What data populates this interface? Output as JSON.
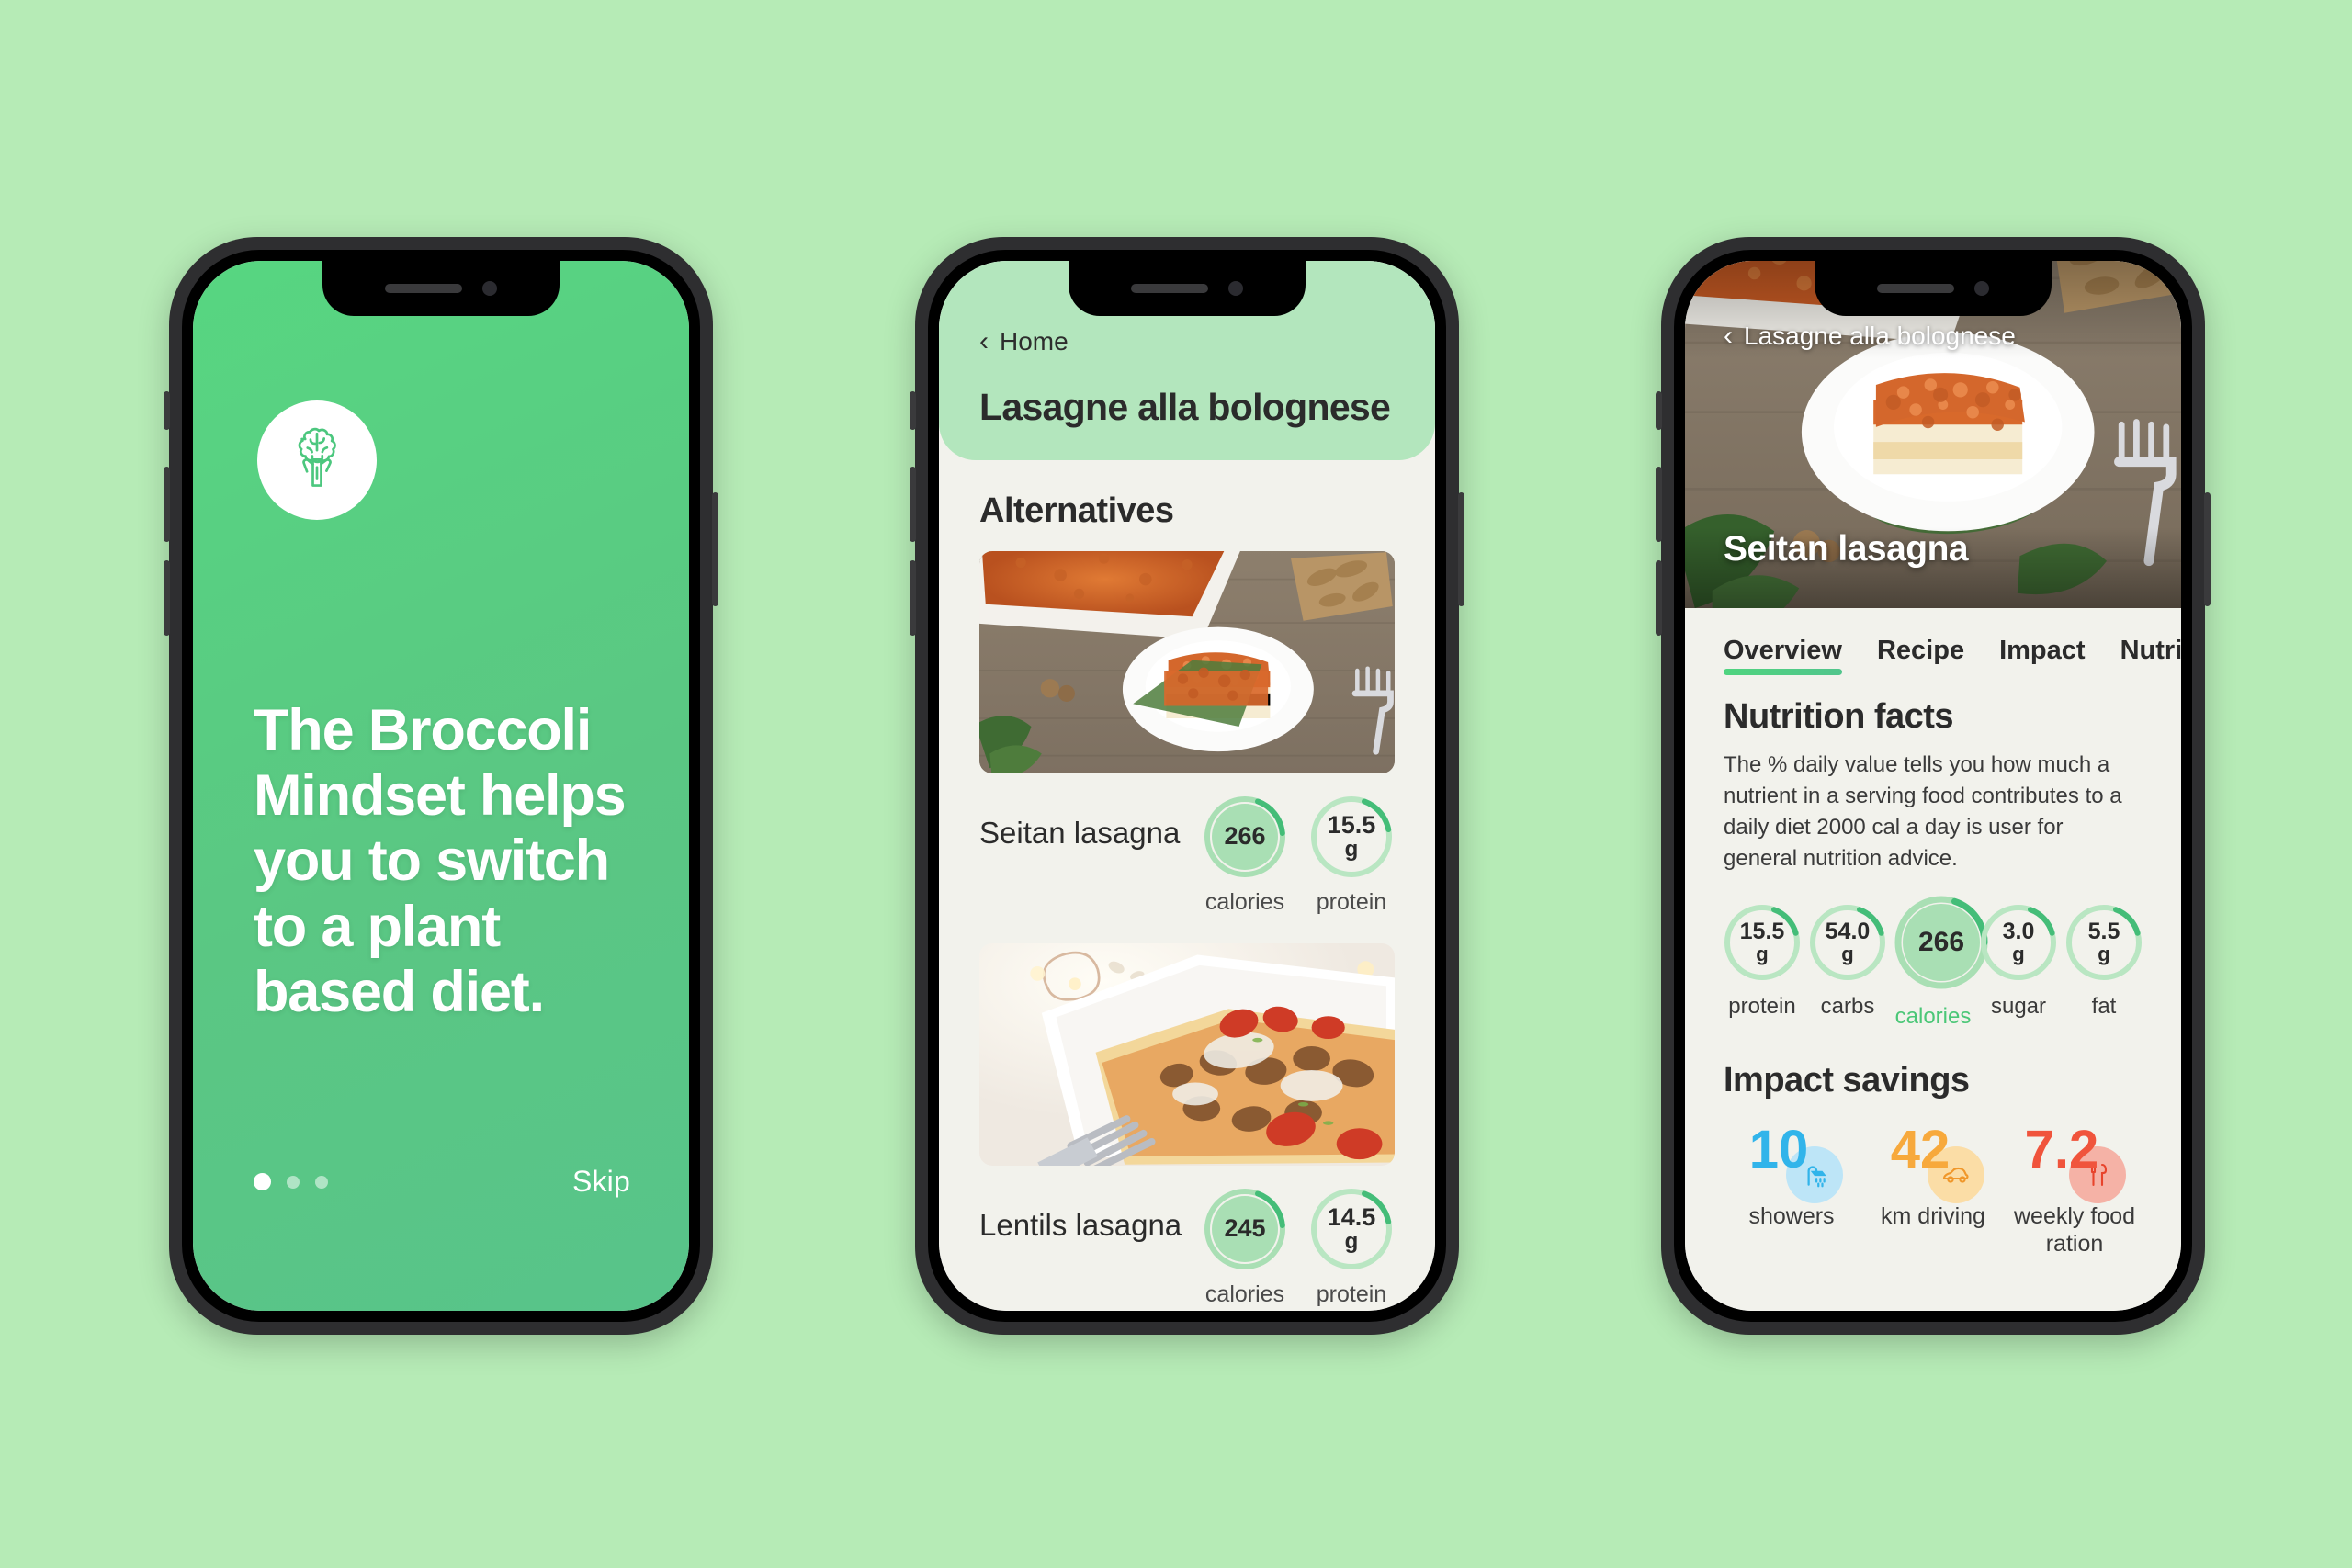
{
  "page": {
    "background_color": "#b6ebb6"
  },
  "phone1": {
    "name": "onboarding-screen",
    "brand_icon": "broccoli-brain-icon",
    "headline": "The Broccoli Mindset helps you to switch to a plant based diet.",
    "background_color": "#57d681",
    "pagination": {
      "total": 3,
      "active_index": 0
    },
    "skip_label": "Skip"
  },
  "phone2": {
    "name": "alternatives-screen",
    "back_icon": "chevron-left-icon",
    "back_label": "Home",
    "header_title": "Lasagne alla bolognese",
    "header_color": "#b3e6bd",
    "section_title": "Alternatives",
    "cards": [
      {
        "name": "Seitan lasagna",
        "photo": "lasagna-tray-plate-photo",
        "badges": [
          {
            "value": "266",
            "unit": "",
            "caption": "calories",
            "filled": true,
            "progress": 0.18
          },
          {
            "value": "15.5",
            "unit": "g",
            "caption": "protein",
            "filled": false,
            "progress": 0.16
          }
        ]
      },
      {
        "name": "Lentils lasagna",
        "photo": "lentils-lasagna-fork-photo",
        "badges": [
          {
            "value": "245",
            "unit": "",
            "caption": "calories",
            "filled": true,
            "progress": 0.18
          },
          {
            "value": "14.5",
            "unit": "g",
            "caption": "protein",
            "filled": false,
            "progress": 0.16
          }
        ]
      }
    ]
  },
  "phone3": {
    "name": "recipe-detail-screen",
    "back_icon": "chevron-left-icon",
    "back_label": "Lasagne alla bolognese",
    "hero_photo": "lasagna-plate-hero-photo",
    "hero_title": "Seitan lasagna",
    "tabs": [
      {
        "label": "Overview",
        "active": true
      },
      {
        "label": "Recipe",
        "active": false
      },
      {
        "label": "Impact",
        "active": false
      },
      {
        "label": "Nutrition",
        "active": false
      }
    ],
    "nutrition_heading": "Nutrition facts",
    "nutrition_note": "The % daily value tells you how much a nutrient in a serving food contributes to a daily diet 2000 cal a day is user for general nutrition advice.",
    "nutrition_facts": [
      {
        "value": "15.5",
        "unit": "g",
        "caption": "protein",
        "highlight": false,
        "progress": 0.15
      },
      {
        "value": "54.0",
        "unit": "g",
        "caption": "carbs",
        "highlight": false,
        "progress": 0.15
      },
      {
        "value": "266",
        "unit": "",
        "caption": "calories",
        "highlight": true,
        "progress": 0.2
      },
      {
        "value": "3.0",
        "unit": "g",
        "caption": "sugar",
        "highlight": false,
        "progress": 0.15
      },
      {
        "value": "5.5",
        "unit": "g",
        "caption": "fat",
        "highlight": false,
        "progress": 0.15
      }
    ],
    "impact_heading": "Impact savings",
    "impact_items": [
      {
        "number": "10",
        "caption": "showers",
        "icon": "shower-icon",
        "color": "#31b4ea",
        "bubble": "#bde5f7"
      },
      {
        "number": "42",
        "caption": "km driving",
        "icon": "car-icon",
        "color": "#f7a93c",
        "bubble": "#fbdda6"
      },
      {
        "number": "7.2",
        "caption": "weekly food ration",
        "icon": "cutlery-icon",
        "color": "#f0543c",
        "bubble": "#f5b2a6"
      }
    ],
    "accent_green": "#4bc777"
  }
}
